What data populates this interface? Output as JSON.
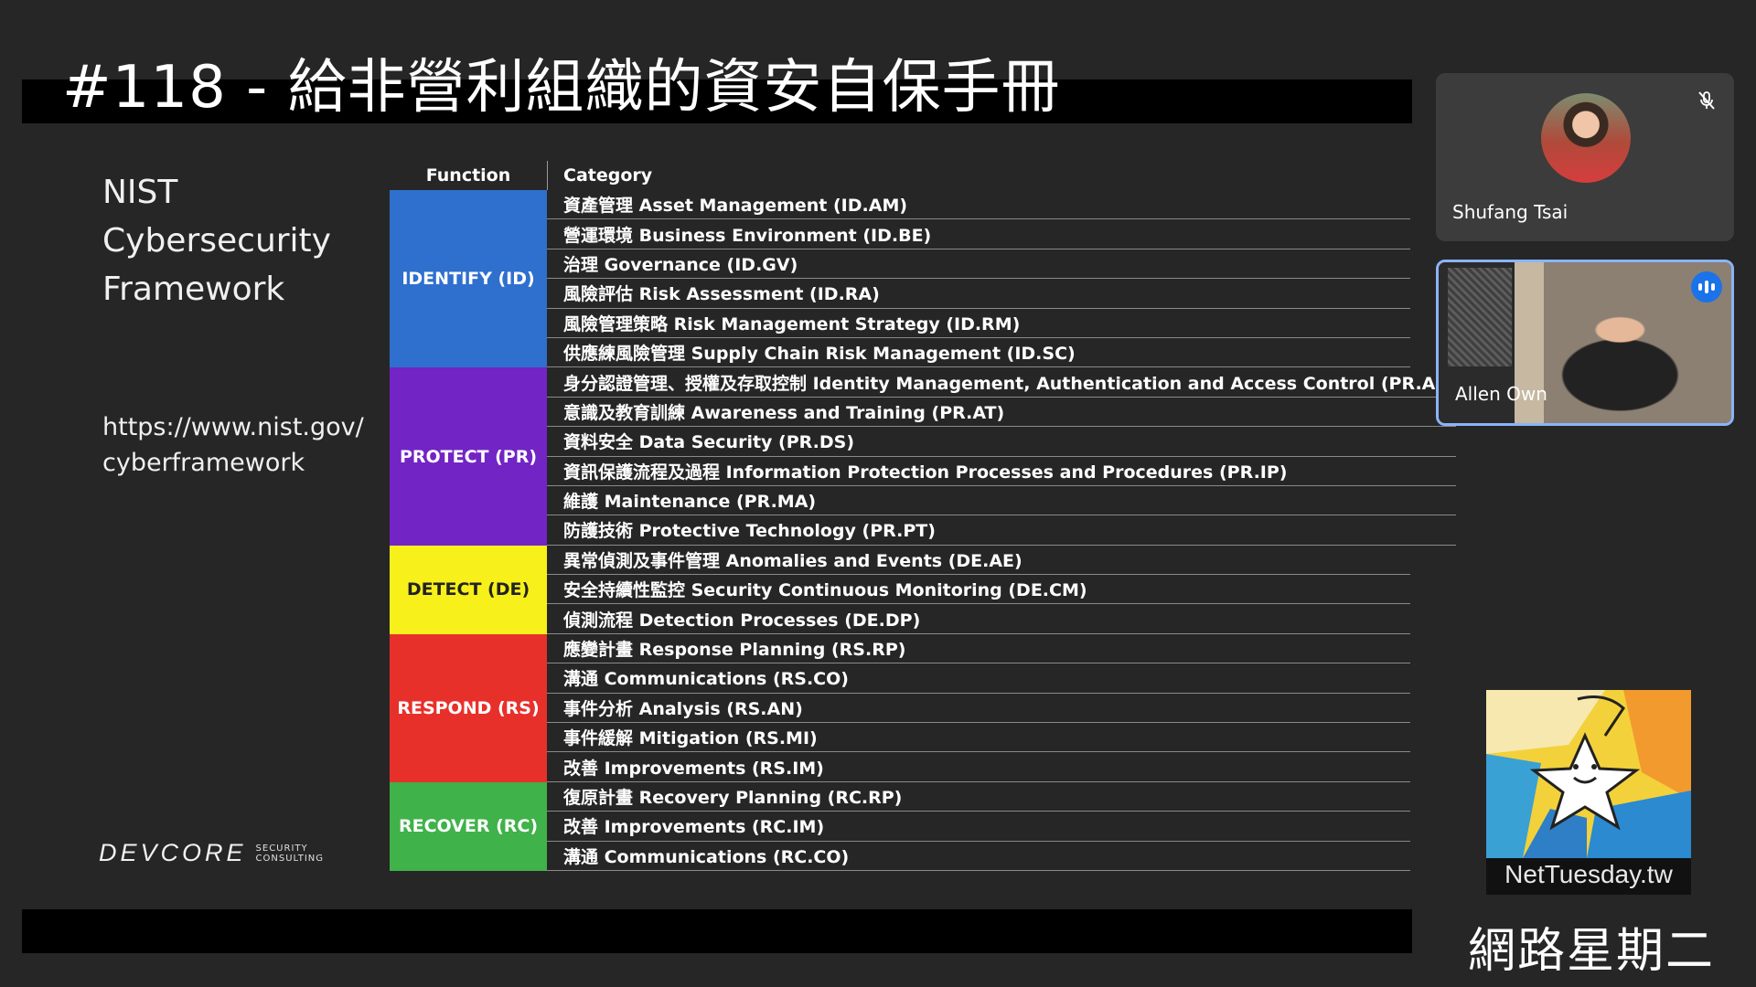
{
  "slide": {
    "title": "#118 - 給非營利組織的資安自保手冊",
    "framework_lines": [
      "NIST",
      "Cybersecurity",
      "Framework"
    ],
    "url_lines": [
      "https://www.nist.gov/",
      "cyberframework"
    ],
    "brand": {
      "word": "DEVCORE",
      "sub1": "SECURITY",
      "sub2": "CONSULTING"
    }
  },
  "table": {
    "header_function": "Function",
    "header_category": "Category",
    "groups": [
      {
        "function": "IDENTIFY (ID)",
        "color": "#2f6fce",
        "categories": [
          "資產管理 Asset Management (ID.AM)",
          "營運環境 Business Environment (ID.BE)",
          "治理 Governance (ID.GV)",
          "風險評估 Risk Assessment (ID.RA)",
          "風險管理策略 Risk Management Strategy (ID.RM)",
          "供應練風險管理 Supply Chain Risk Management (ID.SC)"
        ]
      },
      {
        "function": "PROTECT (PR)",
        "color": "#7224c4",
        "categories": [
          "身分認證管理、授權及存取控制 Identity Management, Authentication and Access Control (PR.AC)",
          "意識及教育訓練 Awareness and Training (PR.AT)",
          "資料安全 Data Security (PR.DS)",
          "資訊保護流程及過程 Information Protection Processes and Procedures (PR.IP)",
          "維護 Maintenance (PR.MA)",
          "防護技術 Protective Technology (PR.PT)"
        ]
      },
      {
        "function": "DETECT (DE)",
        "color": "#f7f01a",
        "categories": [
          "異常偵測及事件管理 Anomalies and Events (DE.AE)",
          "安全持續性監控 Security Continuous Monitoring (DE.CM)",
          "偵測流程 Detection Processes (DE.DP)"
        ]
      },
      {
        "function": "RESPOND (RS)",
        "color": "#e8302b",
        "categories": [
          "應變計畫 Response Planning (RS.RP)",
          "溝通 Communications (RS.CO)",
          "事件分析 Analysis (RS.AN)",
          "事件緩解 Mitigation (RS.MI)",
          "改善 Improvements (RS.IM)"
        ]
      },
      {
        "function": "RECOVER (RC)",
        "color": "#3fb24a",
        "categories": [
          "復原計畫 Recovery Planning (RC.RP)",
          "改善 Improvements (RC.IM)",
          "溝通 Communications (RC.CO)"
        ]
      }
    ]
  },
  "participants": [
    {
      "name": "Shufang Tsai",
      "muted": true,
      "icon": "mic-off-icon"
    },
    {
      "name": "Allen Own",
      "speaking": true,
      "icon": "speaking-indicator-icon"
    }
  ],
  "logo": {
    "text": "NetTuesday.tw",
    "tagline": "網路星期二"
  }
}
